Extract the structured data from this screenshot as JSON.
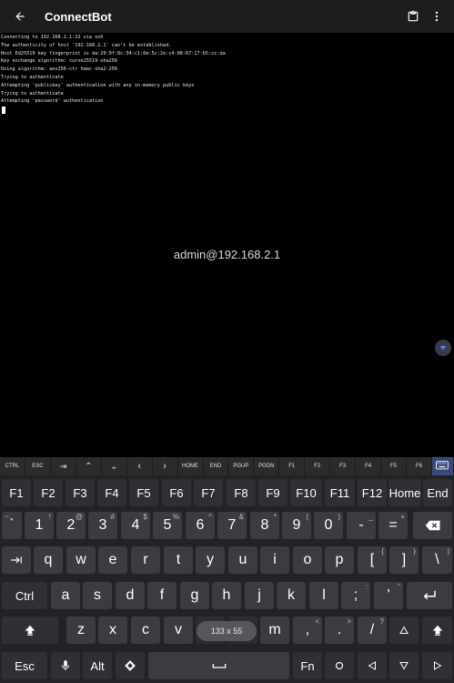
{
  "app": {
    "title": "ConnectBot"
  },
  "terminal": {
    "lines": [
      "Connecting to 192.168.2.1:22 via ssh",
      "The authenticity of host '192.168.2.1' can't be established.",
      "Host Ed25519 key fingerprint is da:29:9f:8c:34:c1:6e:5c:2e:c4:08:67:17:b5:cc:da",
      "Key exchange algorithm: curve25519-sha256",
      "Using algorithm: aes256-ctr hmac-sha2-256",
      "Trying to authenticate",
      "Attempting 'publickey' authentication with any in-memory public keys",
      "Trying to authenticate",
      "Attempting 'password' authentication"
    ],
    "host_overlay": "admin@192.168.2.1"
  },
  "keybar": [
    "CTRL",
    "ESC",
    "⇥",
    "⌃",
    "⌄",
    "‹",
    "›",
    "HOME",
    "END",
    "PGUP",
    "PGDN",
    "F1",
    "F2",
    "F3",
    "F4",
    "F5",
    "F6"
  ],
  "keyboard": {
    "row_f": [
      "F1",
      "F2",
      "F3",
      "F4",
      "F5",
      "F6",
      "F7",
      "F8",
      "F9",
      "F10",
      "F11",
      "F12",
      "Home",
      "End"
    ],
    "row_num": [
      {
        "k": "`",
        "s": "~"
      },
      {
        "k": "1",
        "s": "!"
      },
      {
        "k": "2",
        "s": "@"
      },
      {
        "k": "3",
        "s": "#"
      },
      {
        "k": "4",
        "s": "$"
      },
      {
        "k": "5",
        "s": "%"
      },
      {
        "k": "6",
        "s": "^"
      },
      {
        "k": "7",
        "s": "&"
      },
      {
        "k": "8",
        "s": "*"
      },
      {
        "k": "9",
        "s": "("
      },
      {
        "k": "0",
        "s": ")"
      },
      {
        "k": "-",
        "s": "_"
      },
      {
        "k": "=",
        "s": "+"
      }
    ],
    "row_q": [
      "q",
      "w",
      "e",
      "r",
      "t",
      "y",
      "u",
      "i",
      "o",
      "p"
    ],
    "row_q_extra": [
      {
        "k": "[",
        "s": "{"
      },
      {
        "k": "]",
        "s": "}"
      },
      {
        "k": "\\",
        "s": "|"
      }
    ],
    "row_a": [
      "a",
      "s",
      "d",
      "f",
      "g",
      "h",
      "j",
      "k",
      "l"
    ],
    "row_a_extra": [
      {
        "k": ";",
        "s": ":"
      },
      {
        "k": "'",
        "s": "\""
      }
    ],
    "row_z": [
      "z",
      "x",
      "c",
      "v",
      "",
      "",
      "m"
    ],
    "row_z_extra": [
      {
        "k": ",",
        "s": "<"
      },
      {
        "k": ".",
        "s": ">"
      },
      {
        "k": "/",
        "s": "?"
      }
    ],
    "ctrl": "Ctrl",
    "esc": "Esc",
    "alt": "Alt",
    "fn": "Fn",
    "size_readout": "133 x 55"
  }
}
